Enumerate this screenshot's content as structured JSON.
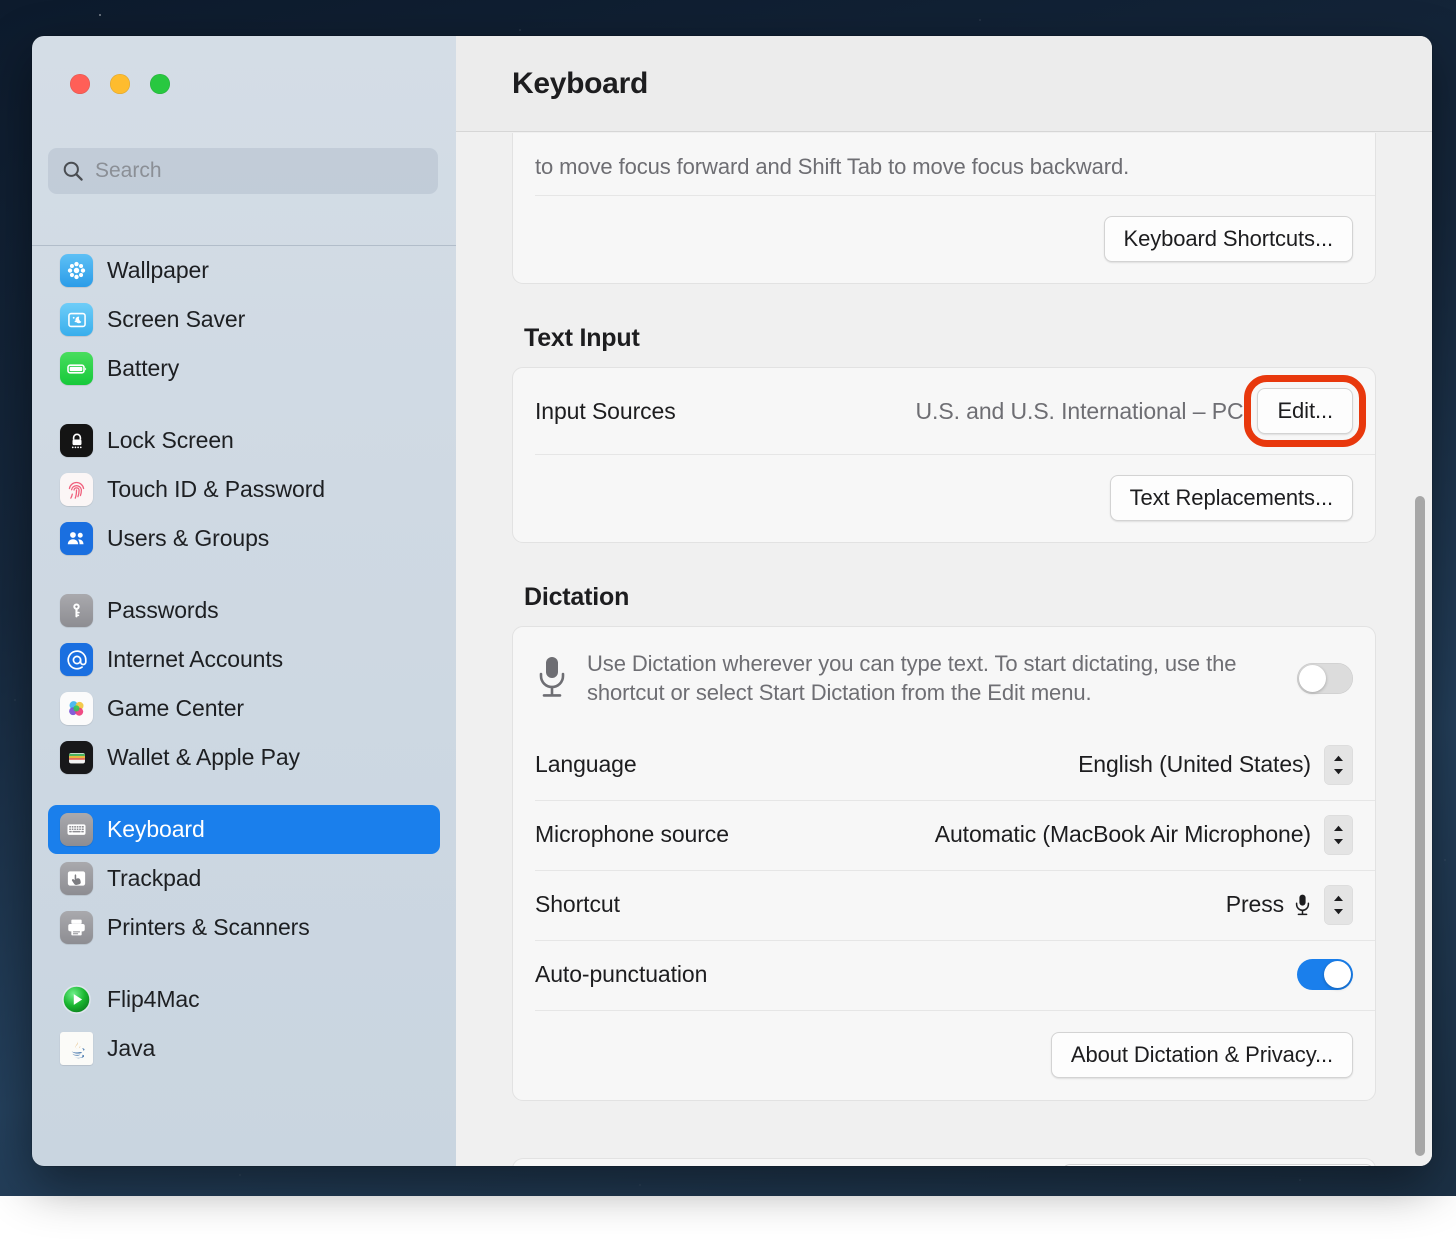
{
  "window": {
    "title": "Keyboard",
    "traffic_lights": [
      "close-button",
      "minimize-button",
      "zoom-button"
    ]
  },
  "sidebar": {
    "search": {
      "placeholder": "Search",
      "value": "",
      "icon": "search-icon"
    },
    "groups": [
      {
        "items": [
          {
            "label": "Wallpaper",
            "icon": "wallpaper-icon"
          },
          {
            "label": "Screen Saver",
            "icon": "screen-saver-icon"
          },
          {
            "label": "Battery",
            "icon": "battery-icon"
          }
        ]
      },
      {
        "items": [
          {
            "label": "Lock Screen",
            "icon": "lock-screen-icon"
          },
          {
            "label": "Touch ID & Password",
            "icon": "touch-id-icon"
          },
          {
            "label": "Users & Groups",
            "icon": "users-groups-icon"
          }
        ]
      },
      {
        "items": [
          {
            "label": "Passwords",
            "icon": "passwords-key-icon"
          },
          {
            "label": "Internet Accounts",
            "icon": "internet-accounts-at-icon"
          },
          {
            "label": "Game Center",
            "icon": "game-center-icon"
          },
          {
            "label": "Wallet & Apple Pay",
            "icon": "wallet-icon"
          }
        ]
      },
      {
        "items": [
          {
            "label": "Keyboard",
            "icon": "keyboard-icon",
            "selected": true
          },
          {
            "label": "Trackpad",
            "icon": "trackpad-icon"
          },
          {
            "label": "Printers & Scanners",
            "icon": "printer-icon"
          }
        ]
      },
      {
        "items": [
          {
            "label": "Flip4Mac",
            "icon": "flip4mac-icon"
          },
          {
            "label": "Java",
            "icon": "java-icon"
          }
        ]
      }
    ]
  },
  "main": {
    "shortcuts_card": {
      "description": "to move focus forward and Shift Tab to move focus backward.",
      "button_label": "Keyboard Shortcuts..."
    },
    "text_input": {
      "section_title": "Text Input",
      "input_sources_label": "Input Sources",
      "input_sources_value": "U.S. and U.S. International – PC",
      "edit_button_label": "Edit...",
      "edit_button_highlight_color": "#e8380d",
      "text_replacements_button_label": "Text Replacements..."
    },
    "dictation": {
      "section_title": "Dictation",
      "mic_icon": "microphone-icon",
      "description": "Use Dictation wherever you can type text. To start dictating, use the shortcut or select Start Dictation from the Edit menu.",
      "enabled": "off",
      "rows": [
        {
          "label": "Language",
          "value": "English (United States)",
          "control": "stepper"
        },
        {
          "label": "Microphone source",
          "value": "Automatic (MacBook Air Microphone)",
          "control": "stepper"
        },
        {
          "label": "Shortcut",
          "value": "Press",
          "control": "stepper-with-mic"
        },
        {
          "label": "Auto-punctuation",
          "value": "",
          "control": "toggle-on"
        }
      ],
      "about_button_label": "About Dictation & Privacy..."
    }
  },
  "colors": {
    "accent_blue": "#1a7fec",
    "highlight_red": "#e8380d",
    "toggle_off": "#dcdcdc",
    "window_bg": "#f0f0f0"
  }
}
